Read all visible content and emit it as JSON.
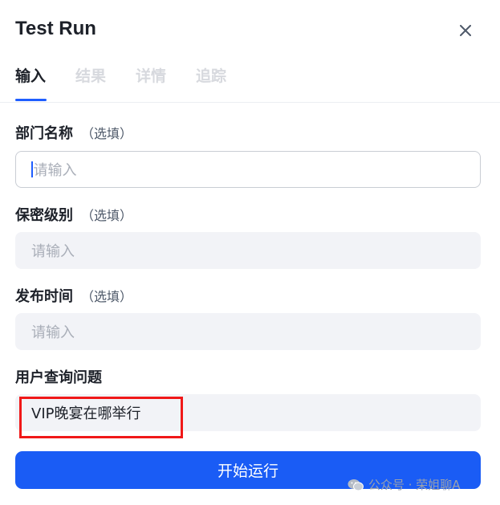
{
  "dialog": {
    "title": "Test Run"
  },
  "tabs": [
    {
      "label": "输入",
      "active": true
    },
    {
      "label": "结果",
      "active": false
    },
    {
      "label": "详情",
      "active": false
    },
    {
      "label": "追踪",
      "active": false
    }
  ],
  "fields": [
    {
      "label": "部门名称",
      "optional": "（选填）",
      "placeholder": "请输入",
      "value": ""
    },
    {
      "label": "保密级别",
      "optional": "（选填）",
      "placeholder": "请输入",
      "value": ""
    },
    {
      "label": "发布时间",
      "optional": "（选填）",
      "placeholder": "请输入",
      "value": ""
    },
    {
      "label": "用户查询问题",
      "optional": "",
      "placeholder": "",
      "value": "VIP晚宴在哪举行"
    }
  ],
  "actions": {
    "run_label": "开始运行"
  },
  "watermark": {
    "text": "公众号 · 荣姐聊A"
  },
  "colors": {
    "accent": "#1a5cf5",
    "highlight": "#f01818"
  }
}
